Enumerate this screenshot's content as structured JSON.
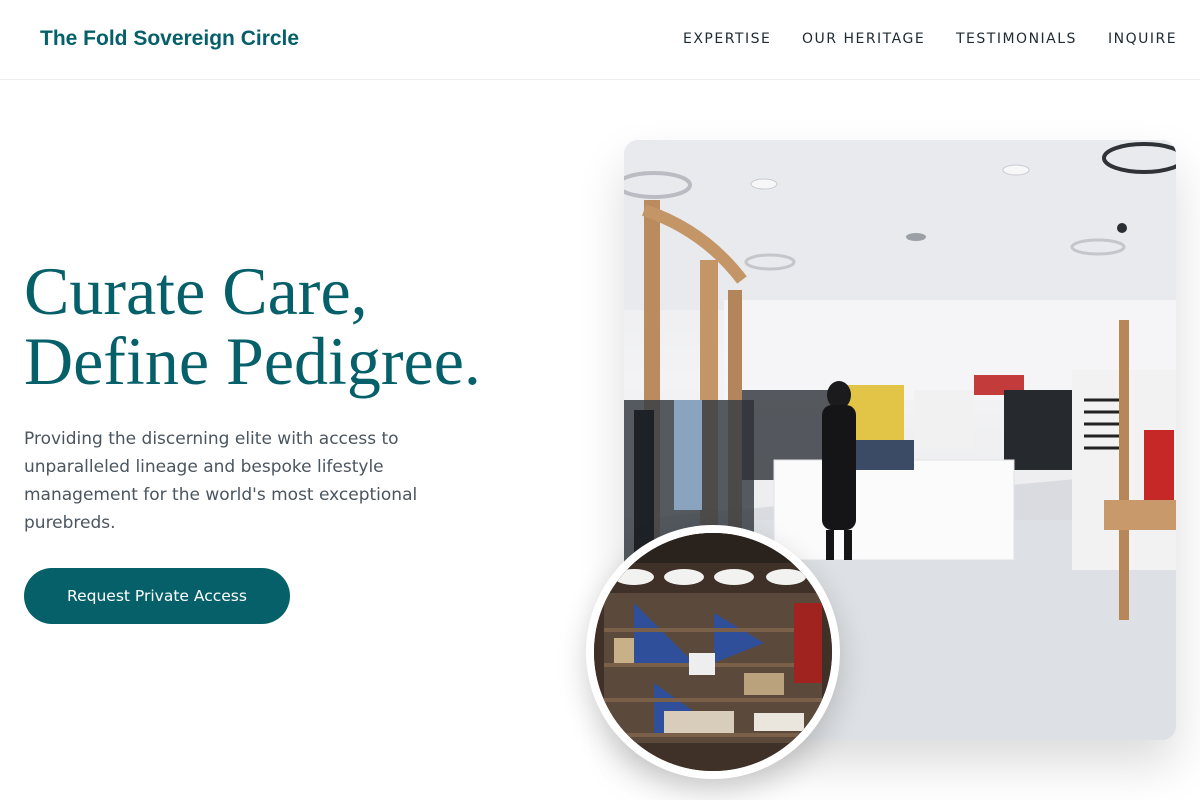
{
  "header": {
    "brand": "The Fold Sovereign Circle",
    "nav": [
      "EXPERTISE",
      "OUR HERITAGE",
      "TESTIMONIALS",
      "INQUIRE"
    ]
  },
  "hero": {
    "headline_line1": "Curate Care,",
    "headline_line2": "Define Pedigree.",
    "subtext": "Providing the discerning elite with access to unparalleled lineage and bespoke lifestyle management for the world's most exceptional purebreds.",
    "cta_label": "Request Private Access"
  },
  "images": {
    "main": "boutique-interior-photo",
    "inset": "shop-shelves-photo"
  },
  "colors": {
    "brand": "#05606a",
    "text": "#4a5560",
    "nav": "#1f2a33"
  }
}
